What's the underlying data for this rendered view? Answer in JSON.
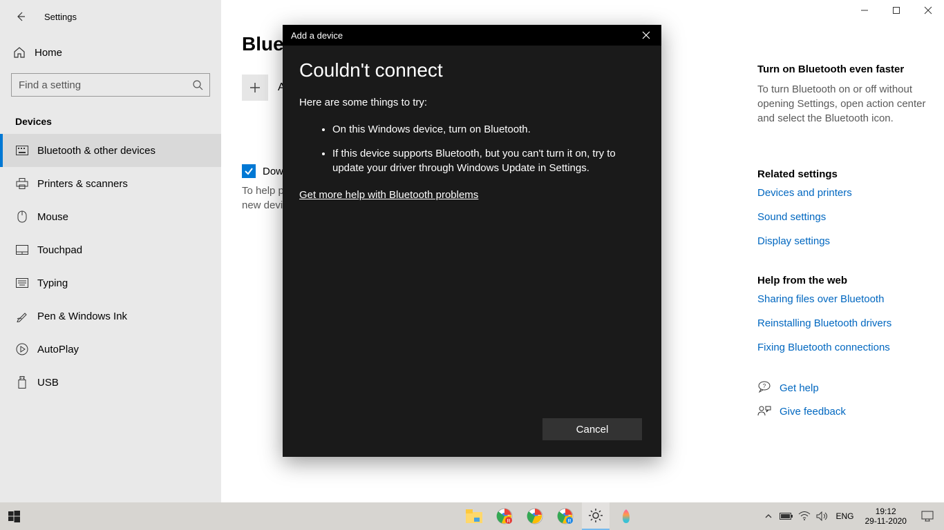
{
  "window": {
    "title": "Settings",
    "home": "Home",
    "search_placeholder": "Find a setting",
    "section": "Devices"
  },
  "sidebar_items": [
    {
      "label": "Bluetooth & other devices",
      "active": true
    },
    {
      "label": "Printers & scanners",
      "active": false
    },
    {
      "label": "Mouse",
      "active": false
    },
    {
      "label": "Touchpad",
      "active": false
    },
    {
      "label": "Typing",
      "active": false
    },
    {
      "label": "Pen & Windows Ink",
      "active": false
    },
    {
      "label": "AutoPlay",
      "active": false
    },
    {
      "label": "USB",
      "active": false
    }
  ],
  "main": {
    "title": "Bluetooth & other devices",
    "add_label": "Add Bluetooth or other device",
    "check_label": "Download over metered connections",
    "help_text": "To help prevent extra charges, keep this off so device software (drivers, info, and apps) for new devices won't download while you're on metered Internet connections."
  },
  "right": {
    "heading1": "Turn on Bluetooth even faster",
    "text1": "To turn Bluetooth on or off without opening Settings, open action center and select the Bluetooth icon.",
    "heading2": "Related settings",
    "links2": [
      "Devices and printers",
      "Sound settings",
      "Display settings"
    ],
    "heading3": "Help from the web",
    "links3": [
      "Sharing files over Bluetooth",
      "Reinstalling Bluetooth drivers",
      "Fixing Bluetooth connections"
    ],
    "get_help": "Get help",
    "give_feedback": "Give feedback"
  },
  "modal": {
    "title": "Add a device",
    "heading": "Couldn't connect",
    "sub": "Here are some things to try:",
    "items": [
      "On this Windows device, turn on Bluetooth.",
      "If this device supports Bluetooth, but you can't turn it on, try to update your driver through Windows Update in Settings."
    ],
    "link": "Get more help with Bluetooth problems",
    "cancel": "Cancel"
  },
  "tray": {
    "lang": "ENG",
    "time": "19:12",
    "date": "29-11-2020"
  }
}
